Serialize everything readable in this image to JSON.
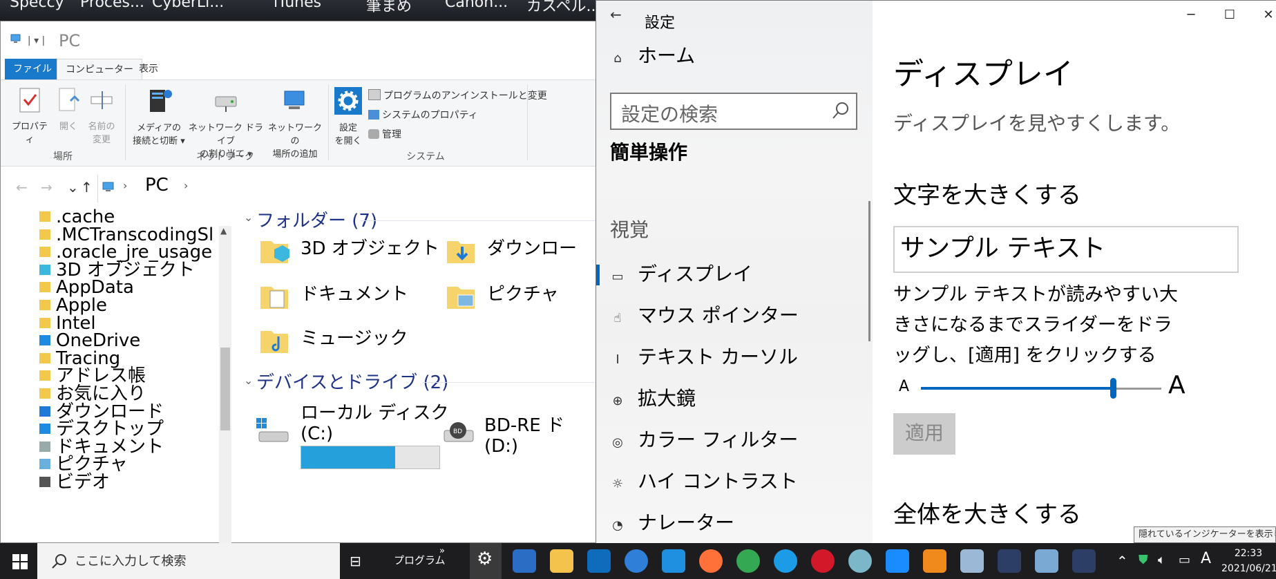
{
  "desktop": {
    "labels": [
      "Speccy",
      "Proces...",
      "CyberLi...",
      "iTunes",
      "筆まめ",
      "Canon...",
      "カスペル..."
    ]
  },
  "explorer": {
    "title": "PC",
    "tabs": [
      "ファイル",
      "コンピューター",
      "表示"
    ],
    "ribbon": {
      "properties": "プロパティ",
      "open": "開く",
      "rename_l1": "名前の",
      "rename_l2": "変更",
      "media_l1": "メディアの",
      "media_l2": "接続と切断 ▾",
      "netdrive_l1": "ネットワーク ドライブ",
      "netdrive_l2": "の割り当て ▾",
      "netloc_l1": "ネットワークの",
      "netloc_l2": "場所の追加",
      "settings_l1": "設定",
      "settings_l2": "を開く",
      "uninstall": "プログラムのアンインストールと変更",
      "sysprops": "システムのプロパティ",
      "manage": "管理",
      "group_location": "場所",
      "group_network": "ネットワーク",
      "group_system": "システム"
    },
    "address": {
      "path": "PC"
    },
    "tree": [
      ".cache",
      ".MCTranscodingSl",
      ".oracle_jre_usage",
      "3D オブジェクト",
      "AppData",
      "Apple",
      "Intel",
      "OneDrive",
      "Tracing",
      "アドレス帳",
      "お気に入り",
      "ダウンロード",
      "デスクトップ",
      "ドキュメント",
      "ピクチャ",
      "ビデオ"
    ],
    "folders_header": "フォルダー (7)",
    "folders": [
      "3D オブジェクト",
      "ダウンロー",
      "ドキュメント",
      "ピクチャ",
      "ミュージック"
    ],
    "drives_header": "デバイスとドライブ (2)",
    "drive_c_l1": "ローカル ディスク",
    "drive_c_l2": "(C:)",
    "drive_c_usage_fraction": 0.68,
    "drive_d_l1": "BD-RE ド",
    "drive_d_l2": "(D:)"
  },
  "settings": {
    "title": "設定",
    "home": "ホーム",
    "search_placeholder": "設定の検索",
    "section": "簡単操作",
    "category": "視覚",
    "nav": [
      "ディスプレイ",
      "マウス ポインター",
      "テキスト カーソル",
      "拡大鏡",
      "カラー フィルター",
      "ハイ コントラスト",
      "ナレーター"
    ],
    "page_title": "ディスプレイ",
    "page_subtitle": "ディスプレイを見やすくします。",
    "text_size_heading": "文字を大きくする",
    "sample_text": "サンプル テキスト",
    "instructions": "サンプル テキストが読みやすい大きさになるまでスライダーをドラッグし、[適用] をクリックする",
    "slider_small": "A",
    "slider_large": "A",
    "slider_fraction": 0.8,
    "apply": "適用",
    "everything_heading": "全体を大きくする"
  },
  "taskbar": {
    "search_placeholder": "ここに入力して検索",
    "program_label": "プログラム",
    "tray_tooltip": "隠れているインジケーターを表示しま",
    "ime": "A",
    "time": "22:33",
    "date": "2021/06/21"
  },
  "colors": {
    "accent": "#0067c0",
    "explorer_blue": "#1979ca",
    "drive_bar": "#26a0da"
  }
}
